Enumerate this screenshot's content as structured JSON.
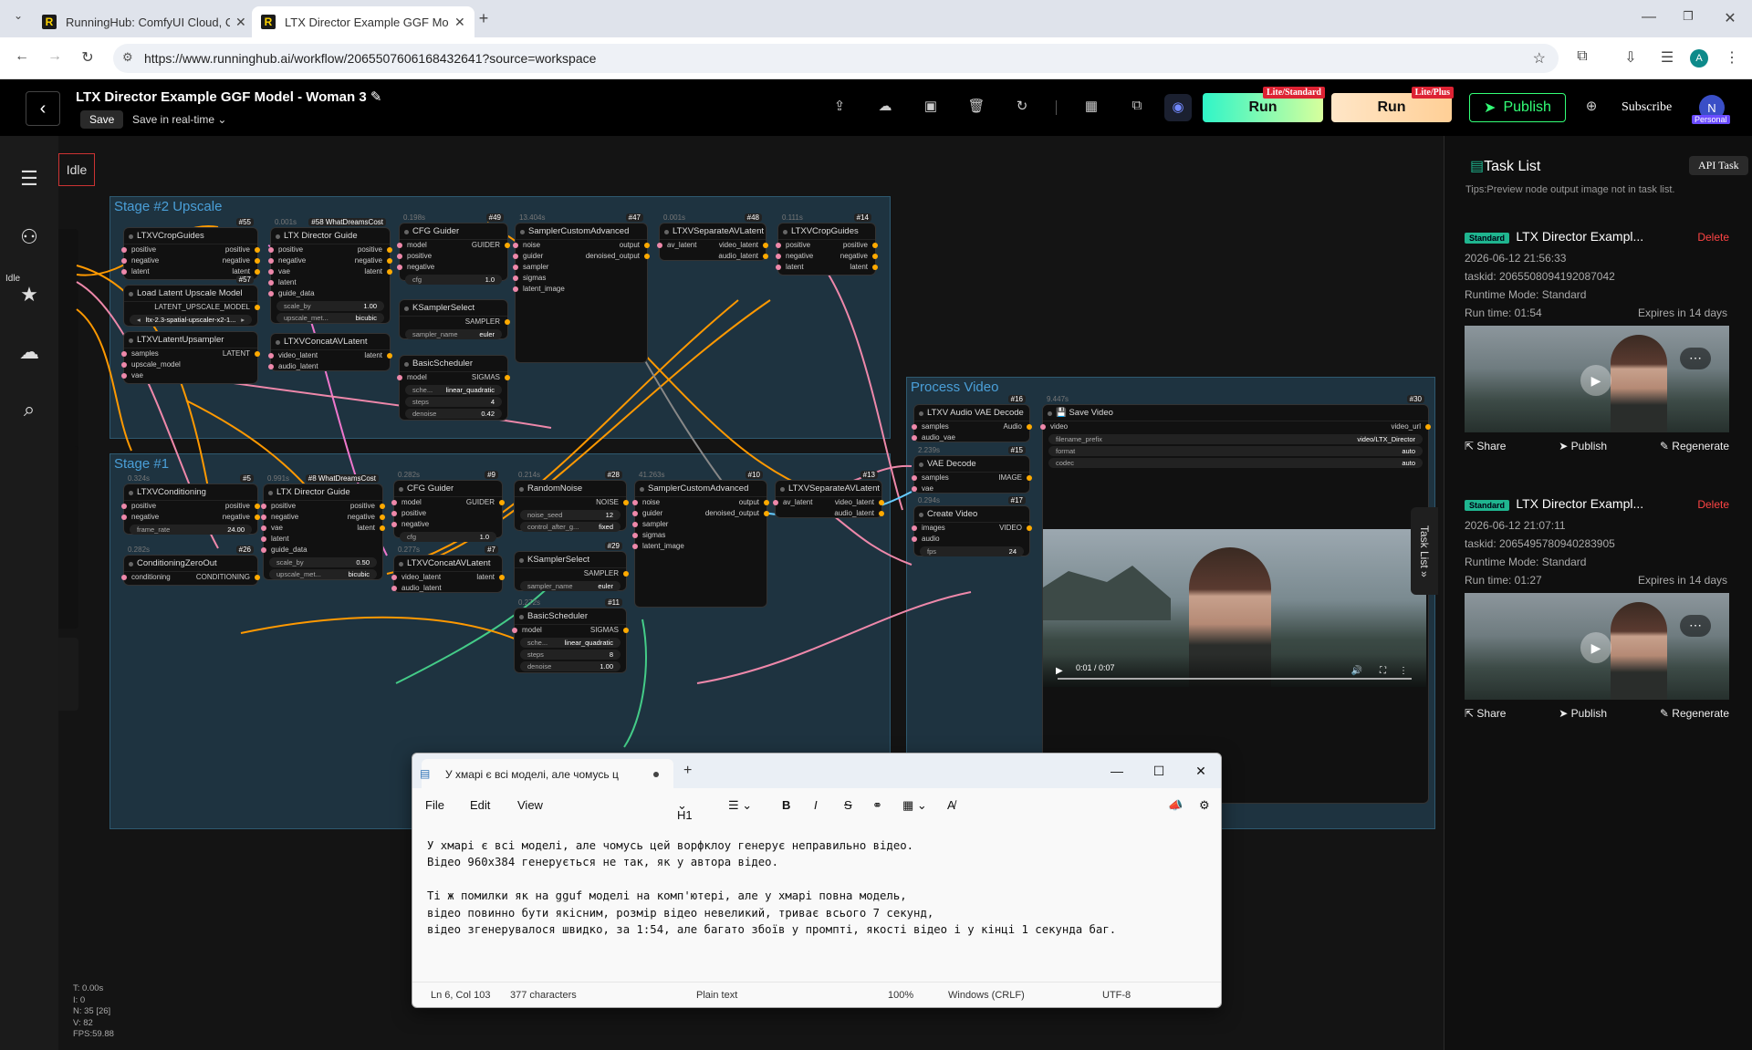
{
  "browser": {
    "tabs": [
      {
        "title": "RunningHub: ComfyUI Cloud, C",
        "active": false
      },
      {
        "title": "LTX Director Example GGF Mod",
        "active": true
      }
    ],
    "url": "https://www.runninghub.ai/workflow/2065507606168432641?source=workspace",
    "profile_letter": "A"
  },
  "header": {
    "workflow_title": "LTX Director Example GGF Model - Woman 3",
    "save_label": "Save",
    "save_mode": "Save in real-time",
    "run_standard_label": "Run",
    "run_standard_tag": "Lite/Standard",
    "run_plus_label": "Run",
    "run_plus_tag": "Lite/Plus",
    "publish_label": "Publish",
    "subscribe_label": "Subscribe",
    "avatar_letter": "N",
    "avatar_tag": "Personal"
  },
  "canvas": {
    "status_small": "Idle",
    "status_badge": "Idle",
    "groups": [
      {
        "title": "Stage #2 Upscale"
      },
      {
        "title": "Stage #1"
      },
      {
        "title": "Process Video"
      }
    ],
    "stats": [
      "T: 0.00s",
      "I: 0",
      "N: 35 [26]",
      "V: 82",
      "FPS:59.88"
    ],
    "video_time": "0:01 / 0:07"
  },
  "nodes": {
    "s2_crop": {
      "title": "LTXVCropGuides",
      "id": "#55",
      "rows": [
        [
          "positive",
          "positive"
        ],
        [
          "negative",
          "negative"
        ],
        [
          "latent",
          "latent"
        ]
      ]
    },
    "s2_lat_up": {
      "title": "Load Latent Upscale Model",
      "id": "#57",
      "out": "LATENT_UPSCALE_MODEL",
      "widget": "ltx-2.3-spatial-upscaler-x2-1..."
    },
    "s2_upsampler": {
      "title": "LTXVLatentUpsampler",
      "rows": [
        [
          "samples",
          "LATENT"
        ],
        [
          "upscale_model",
          ""
        ],
        [
          "vae",
          ""
        ]
      ]
    },
    "s2_director": {
      "title": "LTX Director Guide",
      "id": "#58 WhatDreamsCost",
      "time": "0.001s",
      "rows": [
        [
          "positive",
          "positive"
        ],
        [
          "negative",
          "negative"
        ],
        [
          "vae",
          "latent"
        ],
        [
          "latent",
          ""
        ],
        [
          "guide_data",
          ""
        ]
      ],
      "w1": [
        "scale_by",
        "1.00"
      ],
      "w2": [
        "upscale_met...",
        "bicubic"
      ]
    },
    "s2_concat": {
      "title": "LTXVConcatAVLatent",
      "rows": [
        [
          "video_latent",
          "latent"
        ],
        [
          "audio_latent",
          ""
        ]
      ]
    },
    "s2_cfg": {
      "title": "CFG Guider",
      "id": "#49",
      "time": "0.198s",
      "rows": [
        [
          "model",
          "GUIDER"
        ],
        [
          "positive",
          ""
        ],
        [
          "negative",
          ""
        ]
      ],
      "w1": [
        "cfg",
        "1.0"
      ]
    },
    "s2_ksel": {
      "title": "KSamplerSelect",
      "out": "SAMPLER",
      "w1": [
        "sampler_name",
        "euler"
      ]
    },
    "s2_sched": {
      "title": "BasicScheduler",
      "rows": [
        [
          "model",
          "SIGMAS"
        ]
      ],
      "w1": [
        "sche...",
        "linear_quadratic"
      ],
      "w2": [
        "steps",
        "4"
      ],
      "w3": [
        "denoise",
        "0.42"
      ]
    },
    "s2_sampler": {
      "title": "SamplerCustomAdvanced",
      "id": "#47",
      "time": "13.404s",
      "rows": [
        [
          "noise",
          "output"
        ],
        [
          "guider",
          "denoised_output"
        ],
        [
          "sampler",
          ""
        ],
        [
          "sigmas",
          ""
        ],
        [
          "latent_image",
          ""
        ]
      ]
    },
    "s2_sep": {
      "title": "LTXVSeparateAVLatent",
      "id": "#48",
      "time": "0.001s",
      "rows": [
        [
          "av_latent",
          "video_latent"
        ],
        [
          "",
          "audio_latent"
        ]
      ]
    },
    "s2_crop2": {
      "title": "LTXVCropGuides",
      "id": "#14",
      "time": "0.111s",
      "rows": [
        [
          "positive",
          "positive"
        ],
        [
          "negative",
          "negative"
        ],
        [
          "latent",
          "latent"
        ]
      ]
    },
    "s1_cond": {
      "title": "LTXVConditioning",
      "id": "#5",
      "time": "0.324s",
      "rows": [
        [
          "positive",
          "positive"
        ],
        [
          "negative",
          "negative"
        ]
      ],
      "w1": [
        "frame_rate",
        "24.00"
      ]
    },
    "s1_zero": {
      "title": "ConditioningZeroOut",
      "id": "#26",
      "time": "0.282s",
      "rows": [
        [
          "conditioning",
          "CONDITIONING"
        ]
      ]
    },
    "s1_director": {
      "title": "LTX Director Guide",
      "id": "#8 WhatDreamsCost",
      "time": "0.991s",
      "rows": [
        [
          "positive",
          "positive"
        ],
        [
          "negative",
          "negative"
        ],
        [
          "vae",
          "latent"
        ],
        [
          "latent",
          ""
        ],
        [
          "guide_data",
          ""
        ]
      ],
      "w1": [
        "scale_by",
        "0.50"
      ],
      "w2": [
        "upscale_met...",
        "bicubic"
      ]
    },
    "s1_cfg": {
      "title": "CFG Guider",
      "id": "#9",
      "time": "0.282s",
      "rows": [
        [
          "model",
          "GUIDER"
        ],
        [
          "positive",
          ""
        ],
        [
          "negative",
          ""
        ]
      ],
      "w1": [
        "cfg",
        "1.0"
      ]
    },
    "s1_concat": {
      "title": "LTXVConcatAVLatent",
      "id": "#7",
      "time": "0.277s",
      "rows": [
        [
          "video_latent",
          "latent"
        ],
        [
          "audio_latent",
          ""
        ]
      ]
    },
    "s1_noise": {
      "title": "RandomNoise",
      "id": "#28",
      "time": "0.214s",
      "out": "NOISE",
      "w1": [
        "noise_seed",
        "12"
      ],
      "w2": [
        "control_after_g...",
        "fixed"
      ]
    },
    "s1_ksel": {
      "title": "KSamplerSelect",
      "id": "#29",
      "out": "SAMPLER",
      "w1": [
        "sampler_name",
        "euler"
      ]
    },
    "s1_sched": {
      "title": "BasicScheduler",
      "id": "#11",
      "time": "0.272s",
      "rows": [
        [
          "model",
          "SIGMAS"
        ]
      ],
      "w1": [
        "sche...",
        "linear_quadratic"
      ],
      "w2": [
        "steps",
        "8"
      ],
      "w3": [
        "denoise",
        "1.00"
      ]
    },
    "s1_sampler": {
      "title": "SamplerCustomAdvanced",
      "id": "#10",
      "time": "41.263s",
      "rows": [
        [
          "noise",
          "output"
        ],
        [
          "guider",
          "denoised_output"
        ],
        [
          "sampler",
          ""
        ],
        [
          "sigmas",
          ""
        ],
        [
          "latent_image",
          ""
        ]
      ]
    },
    "s1_sep": {
      "title": "LTXVSeparateAVLatent",
      "id": "#13",
      "rows": [
        [
          "av_latent",
          "video_latent"
        ],
        [
          "",
          "audio_latent"
        ]
      ]
    },
    "pv_audio": {
      "title": "LTXV Audio VAE Decode",
      "id": "#16",
      "rows": [
        [
          "samples",
          "Audio"
        ],
        [
          "audio_vae",
          ""
        ]
      ]
    },
    "pv_vae": {
      "title": "VAE Decode",
      "id": "#15",
      "time": "2.239s",
      "rows": [
        [
          "samples",
          "IMAGE"
        ],
        [
          "vae",
          ""
        ]
      ]
    },
    "pv_create": {
      "title": "Create Video",
      "id": "#17",
      "time": "0.294s",
      "rows": [
        [
          "images",
          "VIDEO"
        ],
        [
          "audio",
          ""
        ]
      ],
      "w1": [
        "fps",
        "24"
      ]
    },
    "pv_save": {
      "title": "Save Video",
      "id": "#30",
      "time": "9.447s",
      "rows": [
        [
          "video",
          "video_url"
        ]
      ],
      "w1": [
        "filename_prefix",
        "video/LTX_Director"
      ],
      "w2": [
        "format",
        "auto"
      ],
      "w3": [
        "codec",
        "auto"
      ]
    }
  },
  "right_panel": {
    "title": "Task List",
    "api_task_label": "API Task",
    "tips": "Tips:Preview node output image not in task list.",
    "side_tab": "Task List",
    "tasks": [
      {
        "badge": "Standard",
        "name": "LTX Director Exampl...",
        "delete": "Delete",
        "date": "2026-06-12 21:56:33",
        "taskid": "taskid: 2065508094192087042",
        "mode": "Runtime Mode: Standard",
        "runtime": "Run time: 01:54",
        "expires": "Expires in 14 days",
        "share": "Share",
        "publish": "Publish",
        "regenerate": "Regenerate"
      },
      {
        "badge": "Standard",
        "name": "LTX Director Exampl...",
        "delete": "Delete",
        "date": "2026-06-12 21:07:11",
        "taskid": "taskid: 2065495780940283905",
        "mode": "Runtime Mode: Standard",
        "runtime": "Run time: 01:27",
        "expires": "Expires in 14 days",
        "share": "Share",
        "publish": "Publish",
        "regenerate": "Regenerate"
      }
    ]
  },
  "notepad": {
    "tab_title": "У хмарі є всі моделі, але чомусь ц",
    "menu": [
      "File",
      "Edit",
      "View"
    ],
    "heading_select": "H1",
    "text": "У хмарі є всі моделі, але чомусь цей ворфклоу генерує неправильно відео.\nВідео 960х384 генерується не так, як у автора відео.\n\nТі ж помилки як на gguf моделі на комп'ютері, але у хмарі повна модель,\nвідео повинно бути якісним, розмір відео невеликий, триває всього 7 секунд,\nвідео згенерувалося швидко, за 1:54, але багато збоїв у промпті, якості відео і у кінці 1 секунда баг.",
    "status": {
      "position": "Ln 6, Col 103",
      "chars": "377 characters",
      "type": "Plain text",
      "zoom": "100%",
      "eol": "Windows (CRLF)",
      "encoding": "UTF-8"
    }
  }
}
